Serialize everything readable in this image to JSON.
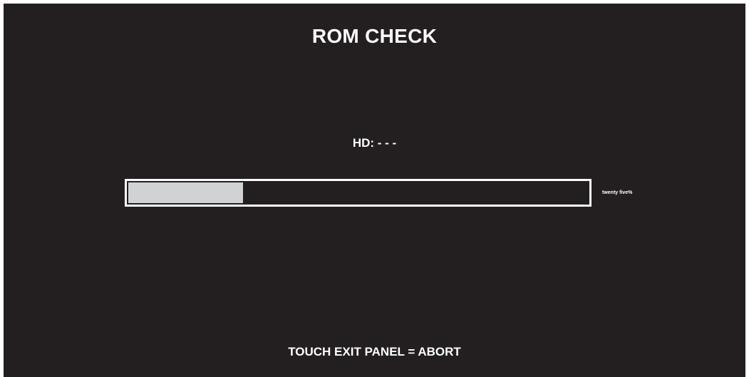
{
  "screen": {
    "title": "ROM CHECK",
    "hd_status": "HD: - - -",
    "progress": {
      "fraction": 0.25,
      "label": "twenty five%"
    },
    "footer_hint": "TOUCH EXIT PANEL = ABORT"
  },
  "colors": {
    "background": "#231f20",
    "text": "#ffffff",
    "progress_fill": "#d1d2d4",
    "progress_border": "#ffffff"
  }
}
